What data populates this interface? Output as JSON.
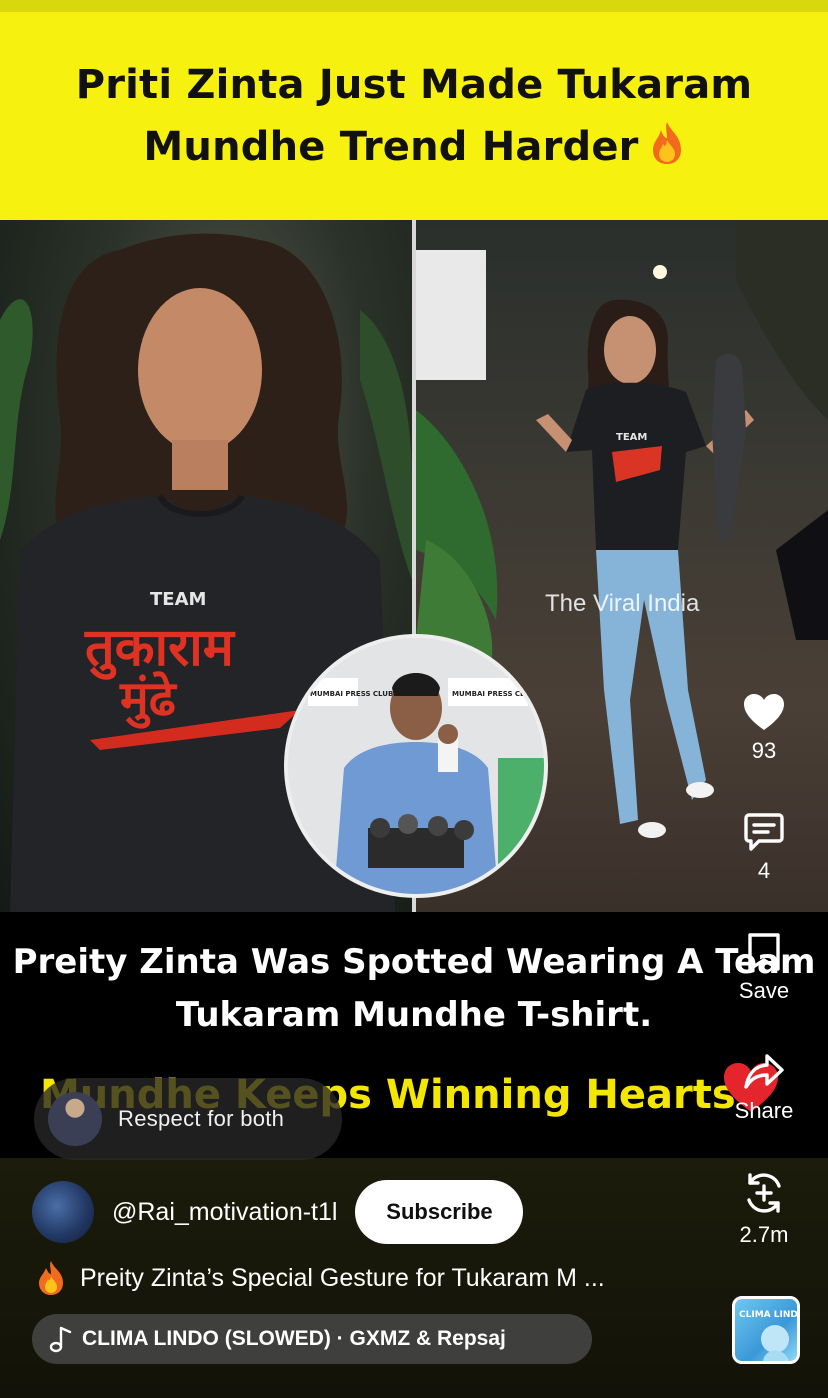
{
  "banner": {
    "line1": "Priti Zinta Just Made Tukaram",
    "line2": "Mundhe Trend Harder"
  },
  "video": {
    "watermark": "The Viral India",
    "shirt_top": "TEAM",
    "shirt_main": "तुकाराम",
    "shirt_sub": "मुंढे",
    "inset_sign_left": "MUMBAI PRESS CLUB",
    "inset_sign_right": "MUMBAI PRESS CLUB",
    "caption_line1": "Preity Zinta Was Spotted Wearing A Team",
    "caption_line2": "Tukaram Mundhe T-shirt.",
    "caption_yellow": "Mundhe Keeps Winning Hearts"
  },
  "comment": {
    "text": "Respect for both"
  },
  "actions": {
    "like_count": "93",
    "comment_count": "4",
    "save_label": "Save",
    "share_label": "Share",
    "remix_count": "2.7m"
  },
  "channel": {
    "handle": "@Rai_motivation-t1l",
    "subscribe_label": "Subscribe"
  },
  "short": {
    "title": "Preity Zinta’s Special Gesture for Tukaram M ..."
  },
  "music": {
    "label": "CLIMA LINDO (SLOWED) · GXMZ & Repsaj",
    "thumb_text": "CLIMA LINDO"
  }
}
